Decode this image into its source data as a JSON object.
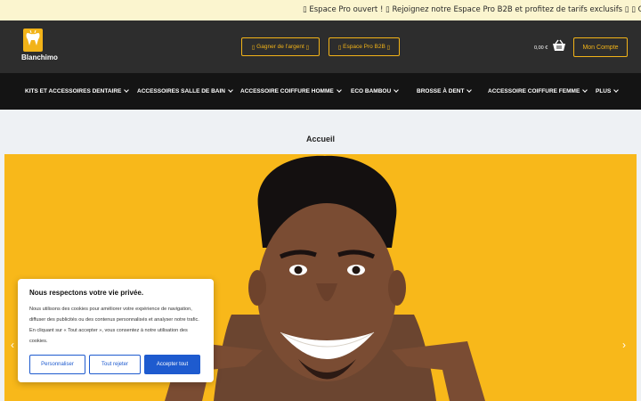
{
  "promo": {
    "text": "▯ Espace Pro ouvert ! ▯ Rejoignez notre Espace Pro B2B et profitez de tarifs exclusifs ▯ ▯ Commandes en volume"
  },
  "header": {
    "logo_text": "Blanchimo",
    "earn_button": "Gagner de l'argent",
    "earn_icon": "▯",
    "earn_icon_trailing": "▯",
    "pro_button": "Espace Pro B2B",
    "pro_icon": "▯",
    "pro_icon_trailing": "▯",
    "cart_total": "0,00 €",
    "account_button": "Mon Compte",
    "accent_color": "#f2b318"
  },
  "nav": {
    "items": [
      {
        "label": "KITS ET ACCESSOIRES DENTAIRE"
      },
      {
        "label": "ACCESSOIRES SALLE DE BAIN"
      },
      {
        "label": "ACCESSOIRE COIFFURE HOMME"
      },
      {
        "label": "ECO BAMBOU"
      },
      {
        "label": "BROSSE À DENT"
      },
      {
        "label": "ACCESSOIRE COIFFURE FEMME"
      },
      {
        "label": "PLUS"
      }
    ]
  },
  "breadcrumb": "Accueil",
  "hero": {
    "arrow_left": "‹",
    "arrow_right": "›"
  },
  "cookie": {
    "title": "Nous respectons votre vie privée.",
    "body": "Nous utilisons des cookies pour améliorer votre expérience de navigation, diffuser des publicités ou des contenus personnalisés et analyser notre trafic. En cliquant sur « Tout accepter », vous consentez à notre utilisation des cookies.",
    "customize": "Personnaliser",
    "reject": "Tout rejeter",
    "accept": "Accepter tout",
    "button_color": "#1e5bcf"
  }
}
